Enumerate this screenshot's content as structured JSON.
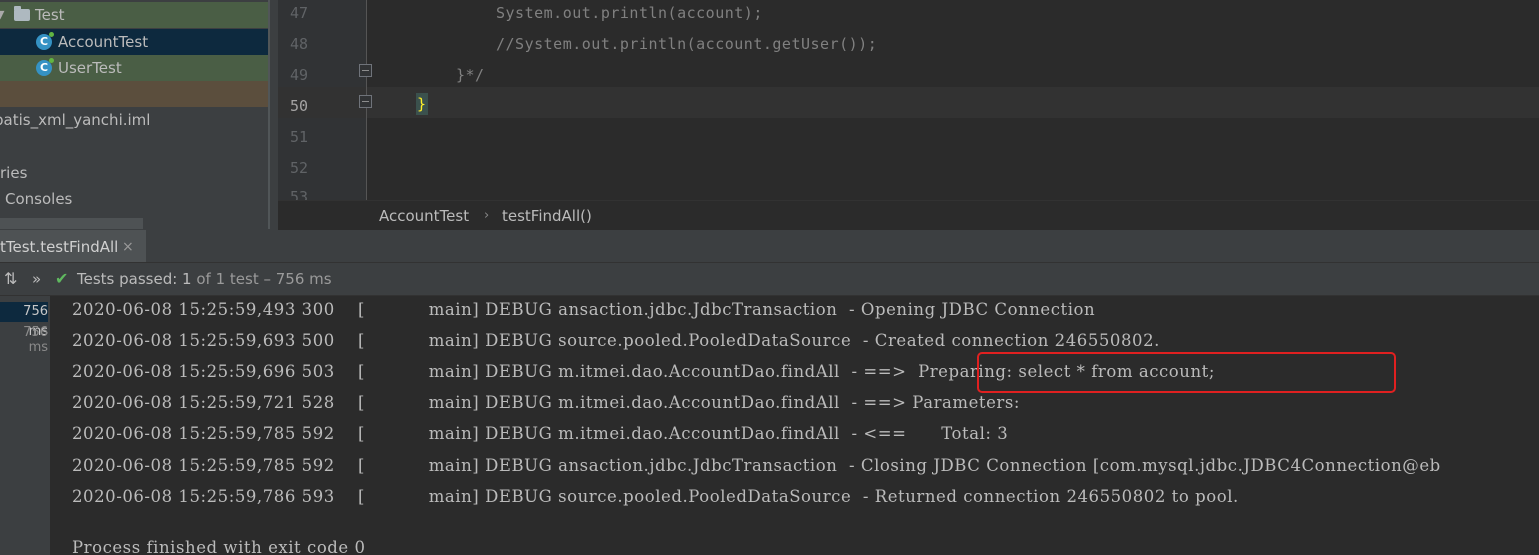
{
  "project_tree": {
    "items": [
      {
        "label": "Test",
        "icon": "folder-icon"
      },
      {
        "label": "AccountTest",
        "icon": "test-class-icon",
        "selected": true
      },
      {
        "label": "UserTest",
        "icon": "test-class-icon"
      },
      {
        "label": "batis_xml_yanchi.iml"
      },
      {
        "label": "ries"
      },
      {
        "label": "Consoles"
      }
    ]
  },
  "editor": {
    "line_numbers": [
      "47",
      "48",
      "49",
      "50",
      "51",
      "52",
      "53"
    ],
    "current_line": "50",
    "code_lines": [
      "System.out.println(account);",
      "//System.out.println(account.getUser());",
      "}*/",
      "}"
    ],
    "breadcrumb": [
      "AccountTest",
      "testFindAll()"
    ]
  },
  "run_panel": {
    "tab_label": "tTest.testFindAll",
    "tab_close": "×",
    "status_prefix": "Tests passed: ",
    "status_count": "1",
    "status_suffix": " of 1 test – 756 ms",
    "durations": [
      "756 ms",
      "756 ms"
    ],
    "log_lines": [
      "2020-06-08 15:25:59,493 300    [           main] DEBUG ansaction.jdbc.JdbcTransaction  - Opening JDBC Connection",
      "2020-06-08 15:25:59,693 500    [           main] DEBUG source.pooled.PooledDataSource  - Created connection 246550802.",
      "2020-06-08 15:25:59,696 503    [           main] DEBUG m.itmei.dao.AccountDao.findAll  - ==>  Preparing: select * from account;",
      "2020-06-08 15:25:59,721 528    [           main] DEBUG m.itmei.dao.AccountDao.findAll  - ==> Parameters: ",
      "2020-06-08 15:25:59,785 592    [           main] DEBUG m.itmei.dao.AccountDao.findAll  - <==      Total: 3",
      "2020-06-08 15:25:59,785 592    [           main] DEBUG ansaction.jdbc.JdbcTransaction  - Closing JDBC Connection [com.mysql.jdbc.JDBC4Connection@eb",
      "2020-06-08 15:25:59,786 593    [           main] DEBUG source.pooled.PooledDataSource  - Returned connection 246550802 to pool.",
      "Process finished with exit code 0"
    ]
  },
  "colors": {
    "accent_highlight": "#e02020",
    "pass_green": "#5fb85f"
  }
}
